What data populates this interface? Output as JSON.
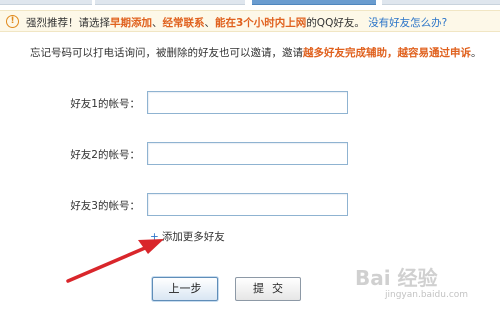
{
  "notice": {
    "icon": "info-circle-icon",
    "icon_glyph": "!",
    "p1": "强烈推荐！请选择",
    "h1": "早期添加",
    "s1": "、",
    "h2": "经常联系",
    "s2": "、",
    "h3": "能在3个小时内上网",
    "p2": "的QQ好友。",
    "link": "没有好友怎么办?"
  },
  "description": {
    "p1": "忘记号码可以打电话询问，被删除的好友也可以邀请，邀请",
    "h1": "越多好友完成辅助，越容易通过申诉",
    "p2": "。"
  },
  "friends": [
    {
      "label": "好友1的帐号：",
      "value": ""
    },
    {
      "label": "好友2的帐号：",
      "value": ""
    },
    {
      "label": "好友3的帐号：",
      "value": ""
    }
  ],
  "add_more": {
    "icon": "plus-icon",
    "glyph": "+",
    "label": "添加更多好友"
  },
  "buttons": {
    "prev": "上一步",
    "submit": "提交"
  },
  "watermark": {
    "logo": "Bai 经验",
    "url": "jingyan.baidu.com"
  },
  "colors": {
    "highlight": "#e0611e",
    "link": "#2b74c8",
    "notice_bg": "#fdf8e8",
    "arrow": "#d9262b"
  }
}
